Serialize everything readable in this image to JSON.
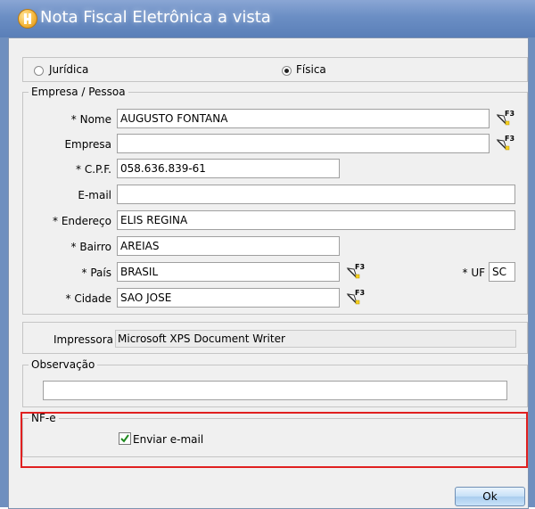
{
  "window": {
    "title": "Nota Fiscal Eletrônica a vista"
  },
  "person_type": {
    "juridica_label": "Jurídica",
    "fisica_label": "Física",
    "selected": "Física"
  },
  "empresa_group": {
    "caption": "Empresa / Pessoa",
    "nome": {
      "label": "* Nome",
      "value": "AUGUSTO FONTANA"
    },
    "empresa": {
      "label": "Empresa",
      "value": ""
    },
    "cpf": {
      "label": "* C.P.F.",
      "value": "058.636.839-61"
    },
    "email": {
      "label": "E-mail",
      "value": ""
    },
    "endereco": {
      "label": "* Endereço",
      "value": "ELIS REGINA"
    },
    "bairro": {
      "label": "* Bairro",
      "value": "AREIAS"
    },
    "pais": {
      "label": "* País",
      "value": "BRASIL"
    },
    "uf": {
      "label": "* UF",
      "value": "SC"
    },
    "cidade": {
      "label": "* Cidade",
      "value": "SAO JOSE"
    }
  },
  "impressora": {
    "label": "Impressora",
    "value": "Microsoft XPS Document Writer"
  },
  "observacao": {
    "caption": "Observação",
    "value": ""
  },
  "nfe": {
    "caption": "NF-e",
    "enviar_email_label": "Enviar e-mail",
    "enviar_email_checked": true
  },
  "ok_button": {
    "label": "Ok"
  },
  "colors": {
    "title_bar": "#6b8ec4",
    "highlight": "#e02020",
    "dialog_bg": "#f0f0f0"
  },
  "icons": {
    "app": "app-logo-icon",
    "lookup": "f3-lookup-icon"
  }
}
